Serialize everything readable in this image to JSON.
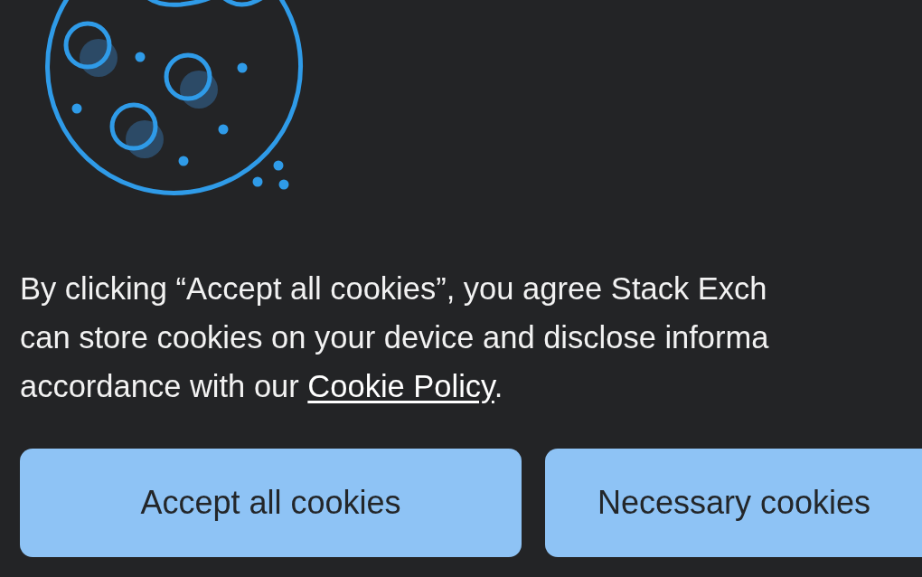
{
  "notice": {
    "lines": [
      "By clicking “Accept all cookies”, you agree Stack Exch",
      "can store cookies on your device and disclose informa"
    ],
    "last_line": {
      "before": "accordance with our ",
      "link": "Cookie Policy",
      "after": "."
    }
  },
  "buttons": [
    {
      "label": "Accept all cookies"
    },
    {
      "label": "Necessary cookies"
    }
  ]
}
